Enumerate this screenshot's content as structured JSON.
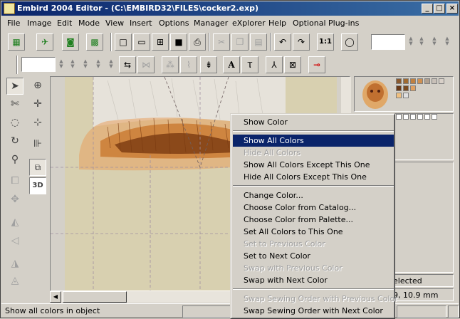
{
  "window": {
    "title": "Embird 2004 Editor - (C:\\EMBIRD32\\FILES\\cocker2.exp)",
    "minimize": "_",
    "maximize": "□",
    "close": "×"
  },
  "menu": [
    "File",
    "Image",
    "Edit",
    "Mode",
    "View",
    "Insert",
    "Options",
    "Manager",
    "eXplorer",
    "Help",
    "Optional Plug-ins"
  ],
  "toolbar": {
    "ratio_button": "1:1"
  },
  "context_menu": {
    "items": [
      {
        "label": "Show Color",
        "enabled": true
      },
      {
        "label": "Show All Colors",
        "enabled": true,
        "selected": true
      },
      {
        "label": "Hide All Colors",
        "enabled": false
      },
      {
        "label": "Show All Colors Except This One",
        "enabled": true
      },
      {
        "label": "Hide All Colors Except This One",
        "enabled": true
      },
      {
        "label": "Change Color...",
        "enabled": true
      },
      {
        "label": "Choose Color from Catalog...",
        "enabled": true
      },
      {
        "label": "Choose Color from Palette...",
        "enabled": true
      },
      {
        "label": "Set All Colors to This One",
        "enabled": true
      },
      {
        "label": "Set to Previous Color",
        "enabled": false
      },
      {
        "label": "Set to Next Color",
        "enabled": true
      },
      {
        "label": "Swap with Previous Color",
        "enabled": false
      },
      {
        "label": "Swap with Next Color",
        "enabled": true
      },
      {
        "label": "Swap Sewing Order with Previous Color",
        "enabled": false
      },
      {
        "label": "Swap Sewing Order with Next Color",
        "enabled": true
      }
    ]
  },
  "right_panel": {
    "selection_text": "elected",
    "size_text": "9, 10.9 mm"
  },
  "status": {
    "message": "Show all colors in object"
  },
  "colors": {
    "stitch_dark": "#7a3a10",
    "stitch_mid": "#c8742a",
    "stitch_light": "#e8a060",
    "highlight": "#0a246a"
  }
}
